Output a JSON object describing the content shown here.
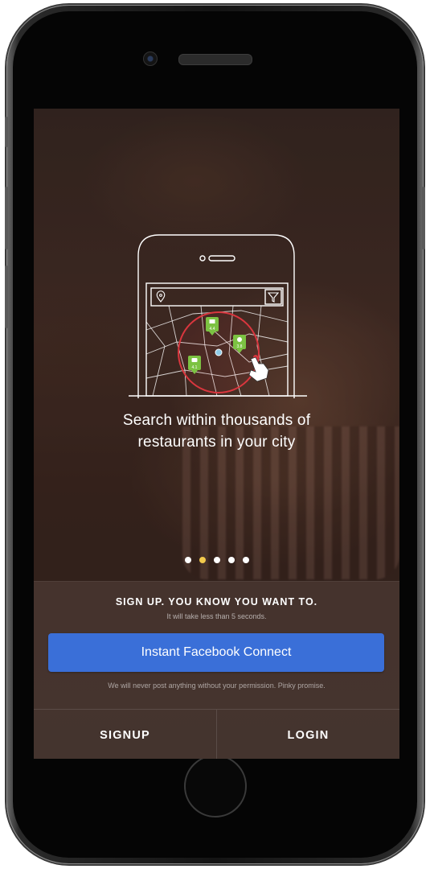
{
  "onboarding": {
    "headline_line1": "Search within thousands of",
    "headline_line2": "restaurants in your city",
    "page_indicator": {
      "total": 5,
      "active_index": 1
    },
    "map_pins": [
      "4.4",
      "3.8",
      "4.1"
    ]
  },
  "signup_panel": {
    "title": "SIGN UP. YOU KNOW YOU WANT TO.",
    "subtitle": "It will take less than 5 seconds.",
    "facebook_button_label": "Instant Facebook Connect",
    "privacy_note": "We will never post anything without your permission. Pinky promise."
  },
  "footer": {
    "signup_label": "SIGNUP",
    "login_label": "LOGIN"
  },
  "colors": {
    "facebook_blue": "#3a6fd8",
    "active_dot": "#f2c94c",
    "pin_green": "#7cc242",
    "radius_red": "#d9363e"
  }
}
